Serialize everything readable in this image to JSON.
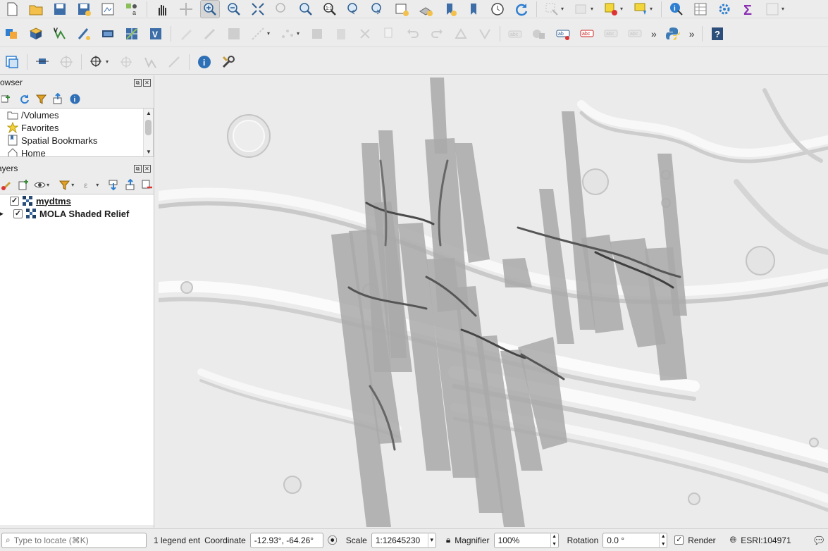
{
  "toolbars": {
    "row1_icons": [
      "new-project-icon",
      "open-project-icon",
      "save-project-icon",
      "save-as-icon",
      "print-layout-icon",
      "style-manager-icon",
      "pan-icon",
      "pan-to-selection-icon",
      "zoom-in-icon",
      "zoom-out-icon",
      "zoom-full-icon",
      "zoom-to-selection-icon",
      "zoom-to-layer-icon",
      "zoom-native-icon",
      "zoom-last-icon",
      "zoom-next-icon",
      "new-map-view-icon",
      "new-3d-view-icon",
      "new-bookmark-icon",
      "show-bookmarks-icon",
      "temporal-controller-icon",
      "refresh-icon",
      "select-features-icon",
      "deselect-icon",
      "select-by-value-icon",
      "annotation-icon",
      "identify-icon",
      "attribute-table-icon",
      "processing-toolbox-icon",
      "statistics-icon",
      "field-calculator-icon"
    ],
    "row2_icons": [
      "data-source-manager-icon",
      "new-geopackage-layer-icon",
      "new-shapefile-layer-icon",
      "new-temporary-layer-icon",
      "new-virtual-layer-icon",
      "georeferencer-icon",
      "vector-tools-icon",
      "current-edits-icon",
      "toggle-editing-icon",
      "save-edits-icon",
      "digitize-icon",
      "vertex-tool-icon",
      "delete-selected-icon",
      "cut-features-icon",
      "copy-features-icon",
      "paste-features-icon",
      "undo-icon",
      "redo-icon",
      "advanced-digitizing-icon",
      "split-features-icon",
      "label-toolbar-icon",
      "pin-labels-icon",
      "show-labels-icon",
      "highlight-labels-icon",
      "move-label-icon",
      "rotate-label-icon",
      "python-console-icon",
      "help-icon"
    ],
    "row3_icons": [
      "georeference-icon",
      "measure-icon",
      "crosshair-icon",
      "snapping-icon",
      "geometry-checker-icon",
      "topology-icon",
      "digitizing-trace-icon",
      "info-icon",
      "settings-wrench-icon"
    ],
    "overflow": "»"
  },
  "browser_panel": {
    "title": "rowser",
    "items": [
      {
        "label": "/Volumes",
        "icon": "folder-icon"
      },
      {
        "label": "Favorites",
        "icon": "star-icon"
      },
      {
        "label": "Spatial Bookmarks",
        "icon": "bookmark-icon"
      },
      {
        "label": "Home",
        "icon": "home-icon"
      }
    ]
  },
  "layers_panel": {
    "title": "ayers",
    "layers": [
      {
        "label": "mydtms",
        "checked": true,
        "underlined": true
      },
      {
        "label": "MOLA Shaded Relief",
        "checked": true,
        "underlined": false
      }
    ]
  },
  "status_bar": {
    "locator_placeholder": "Type to locate (⌘K)",
    "legend_text": "1 legend ent",
    "coordinate_label": "Coordinate",
    "coordinate_value": "-12.93°, -64.26°",
    "scale_label": "Scale",
    "scale_value": "1:12645230",
    "magnifier_label": "Magnifier",
    "magnifier_value": "100%",
    "rotation_label": "Rotation",
    "rotation_value": "0.0 °",
    "render_label": "Render",
    "render_checked": true,
    "crs_label": "ESRI:104971"
  },
  "map": {
    "description_layers": [
      "MOLA Shaded Relief",
      "mydtms"
    ]
  }
}
